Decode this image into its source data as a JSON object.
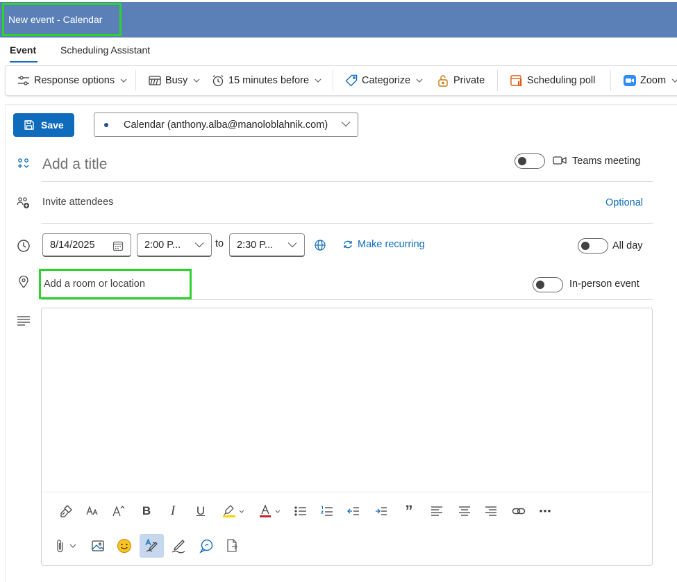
{
  "window": {
    "title": "New event - Calendar"
  },
  "tabs": [
    {
      "label": "Event",
      "active": true
    },
    {
      "label": "Scheduling Assistant",
      "active": false
    }
  ],
  "ribbon": {
    "response_options": "Response options",
    "busy": "Busy",
    "reminder": "15 minutes before",
    "categorize": "Categorize",
    "private": "Private",
    "scheduling_poll": "Scheduling poll",
    "zoom": "Zoom"
  },
  "actions": {
    "save": "Save"
  },
  "calendar_select": {
    "value": "Calendar (anthony.alba@manoloblahnik.com)"
  },
  "form": {
    "title_placeholder": "Add a title",
    "teams_meeting": "Teams meeting",
    "invite_placeholder": "Invite attendees",
    "optional": "Optional",
    "start_date": "8/14/2025",
    "start_time": "2:00 P...",
    "to": "to",
    "end_time": "2:30 P...",
    "make_recurring": "Make recurring",
    "all_day": "All day",
    "location_placeholder": "Add a room or location",
    "in_person": "In-person event"
  },
  "format_toolbar": {
    "bold": "B",
    "italic": "I",
    "underline": "U",
    "quote": "”",
    "more": "⋯"
  },
  "colors": {
    "titlebar": "#5b80b8",
    "accent": "#0f6cbd",
    "highlight_outline": "#2bd42b",
    "highlighter": "#f5d600",
    "font_color": "#c4262e",
    "poll_orange": "#e8590c",
    "zoom_blue": "#2d8cff",
    "emoji_yellow": "#f7c325"
  }
}
